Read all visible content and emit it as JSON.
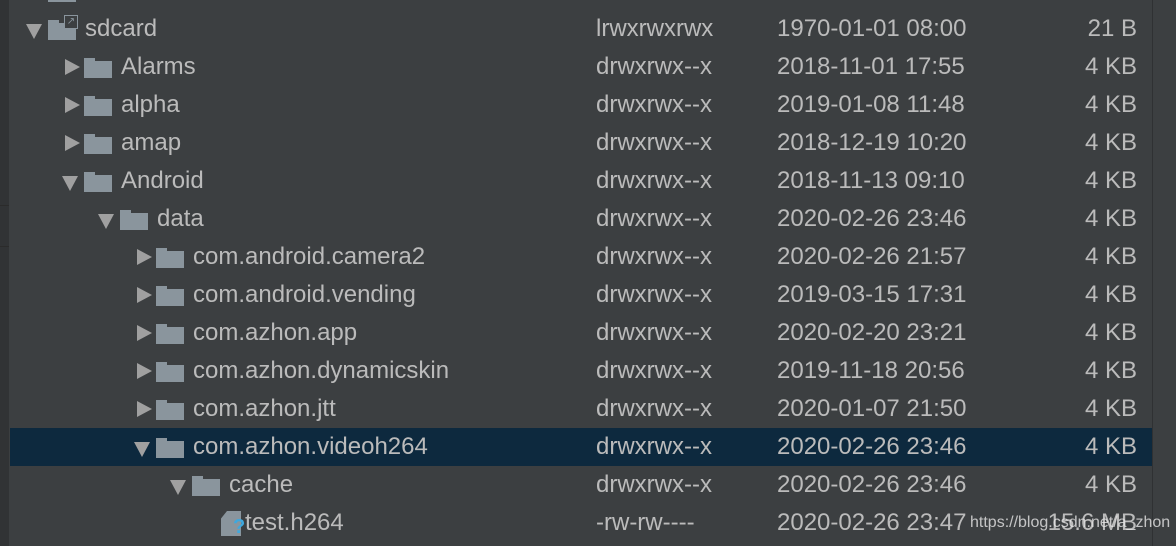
{
  "tree": [
    {
      "name": "",
      "perm": "",
      "date": "",
      "size": "",
      "level": 0,
      "arrow": "none",
      "icon": "folder"
    },
    {
      "name": "sdcard",
      "perm": "lrwxrwxrwx",
      "date": "1970-01-01 08:00",
      "size": "21 B",
      "level": 0,
      "arrow": "down",
      "icon": "folder-link"
    },
    {
      "name": "Alarms",
      "perm": "drwxrwx--x",
      "date": "2018-11-01 17:55",
      "size": "4 KB",
      "level": 1,
      "arrow": "right",
      "icon": "folder"
    },
    {
      "name": "alpha",
      "perm": "drwxrwx--x",
      "date": "2019-01-08 11:48",
      "size": "4 KB",
      "level": 1,
      "arrow": "right",
      "icon": "folder"
    },
    {
      "name": "amap",
      "perm": "drwxrwx--x",
      "date": "2018-12-19 10:20",
      "size": "4 KB",
      "level": 1,
      "arrow": "right",
      "icon": "folder"
    },
    {
      "name": "Android",
      "perm": "drwxrwx--x",
      "date": "2018-11-13 09:10",
      "size": "4 KB",
      "level": 1,
      "arrow": "down",
      "icon": "folder"
    },
    {
      "name": "data",
      "perm": "drwxrwx--x",
      "date": "2020-02-26 23:46",
      "size": "4 KB",
      "level": 2,
      "arrow": "down",
      "icon": "folder"
    },
    {
      "name": "com.android.camera2",
      "perm": "drwxrwx--x",
      "date": "2020-02-26 21:57",
      "size": "4 KB",
      "level": 3,
      "arrow": "right",
      "icon": "folder"
    },
    {
      "name": "com.android.vending",
      "perm": "drwxrwx--x",
      "date": "2019-03-15 17:31",
      "size": "4 KB",
      "level": 3,
      "arrow": "right",
      "icon": "folder"
    },
    {
      "name": "com.azhon.app",
      "perm": "drwxrwx--x",
      "date": "2020-02-20 23:21",
      "size": "4 KB",
      "level": 3,
      "arrow": "right",
      "icon": "folder"
    },
    {
      "name": "com.azhon.dynamicskin",
      "perm": "drwxrwx--x",
      "date": "2019-11-18 20:56",
      "size": "4 KB",
      "level": 3,
      "arrow": "right",
      "icon": "folder"
    },
    {
      "name": "com.azhon.jtt",
      "perm": "drwxrwx--x",
      "date": "2020-01-07 21:50",
      "size": "4 KB",
      "level": 3,
      "arrow": "right",
      "icon": "folder"
    },
    {
      "name": "com.azhon.videoh264",
      "perm": "drwxrwx--x",
      "date": "2020-02-26 23:46",
      "size": "4 KB",
      "level": 3,
      "arrow": "down",
      "icon": "folder",
      "selected": true
    },
    {
      "name": "cache",
      "perm": "drwxrwx--x",
      "date": "2020-02-26 23:46",
      "size": "4 KB",
      "level": 4,
      "arrow": "down",
      "icon": "folder"
    },
    {
      "name": "test.h264",
      "perm": "-rw-rw----",
      "date": "2020-02-26 23:47",
      "size": "15.6 MB",
      "level": 5,
      "arrow": "none",
      "icon": "unknown-file"
    }
  ],
  "watermark": "https://blog.csdn.net/a_zhon",
  "colors": {
    "background": "#3c3f41",
    "selection": "#0d293e",
    "text": "#bbbbbb",
    "folder": "#8a959d",
    "unknown": "#3ea8de"
  }
}
